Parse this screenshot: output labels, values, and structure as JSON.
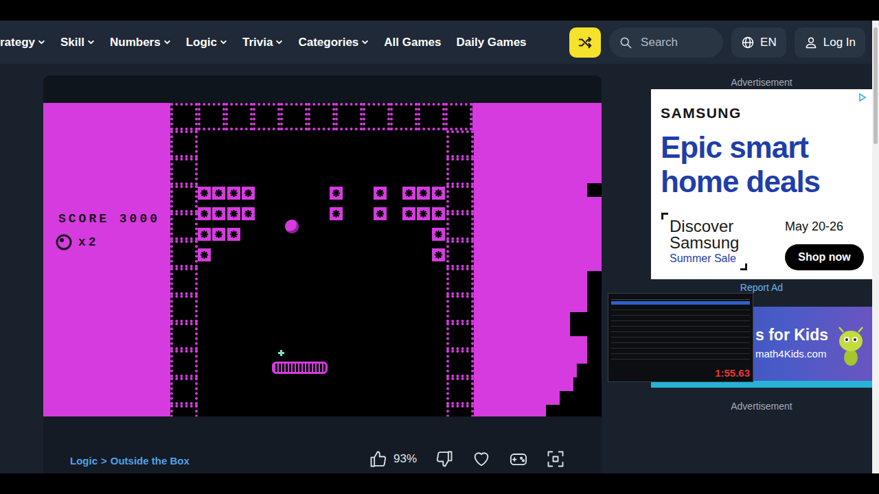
{
  "nav": {
    "items": [
      {
        "label": "rategy",
        "dropdown": true
      },
      {
        "label": "Skill",
        "dropdown": true
      },
      {
        "label": "Numbers",
        "dropdown": true
      },
      {
        "label": "Logic",
        "dropdown": true
      },
      {
        "label": "Trivia",
        "dropdown": true
      },
      {
        "label": "Categories",
        "dropdown": true
      },
      {
        "label": "All Games",
        "dropdown": false
      },
      {
        "label": "Daily Games",
        "dropdown": false
      }
    ],
    "search": {
      "placeholder": "Search"
    },
    "language": "EN",
    "login": "Log In"
  },
  "game": {
    "hud": {
      "score": "SCORE 3000",
      "lives": "x2"
    },
    "brick_rows": [
      {
        "bricks": [
          true,
          true,
          true,
          true,
          false,
          false,
          false,
          false,
          false,
          true,
          false,
          false,
          true,
          false,
          true,
          true,
          true
        ]
      },
      {
        "bricks": [
          true,
          true,
          true,
          true,
          false,
          false,
          false,
          false,
          false,
          true,
          false,
          false,
          true,
          false,
          true,
          true,
          true
        ]
      },
      {
        "bricks": [
          true,
          true,
          true,
          false,
          false,
          false,
          false,
          false,
          false,
          false,
          false,
          false,
          false,
          false,
          false,
          false,
          true
        ]
      },
      {
        "bricks": [
          true,
          false,
          false,
          false,
          false,
          false,
          false,
          false,
          false,
          false,
          false,
          false,
          false,
          false,
          false,
          false,
          true
        ]
      }
    ]
  },
  "game_footer": {
    "breadcrumb": [
      "Logic",
      "Outside the Box"
    ],
    "separator": ">",
    "rating": "93%"
  },
  "sidebar": {
    "label_top": "Advertisement",
    "samsung_ad": {
      "brand": "SAMSUNG",
      "headline": [
        "Epic smart",
        "home deals"
      ],
      "discover": [
        "Discover",
        "Samsung"
      ],
      "sale": "Summer Sale",
      "dates": "May 20-26",
      "cta": "Shop now"
    },
    "report": "Report Ad",
    "kids_ad": {
      "title": "s for Kids",
      "url": "math4Kids.com"
    },
    "label_bottom": "Advertisement"
  },
  "timer_window": {
    "time": "1:55.63"
  }
}
